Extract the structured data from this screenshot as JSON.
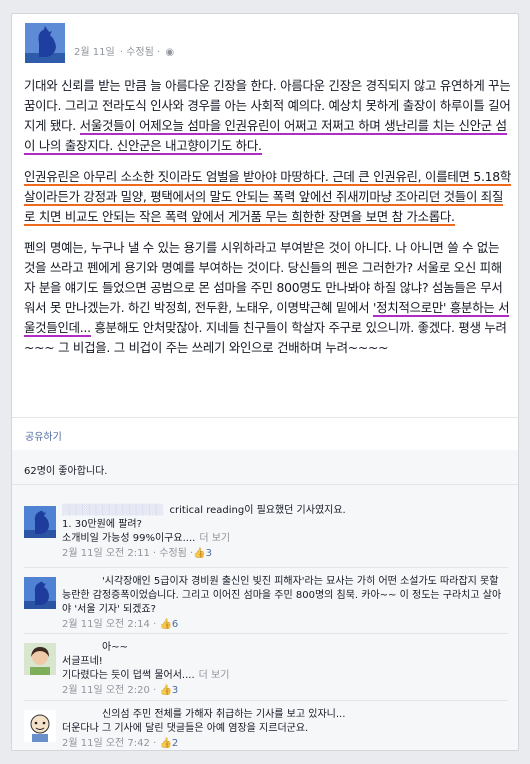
{
  "post": {
    "date": "2월 11일",
    "edited": "· 수정됨 ·",
    "paragraphs": [
      [
        {
          "t": "기대와 신뢰를 받는 만큼 늘 아름다운 긴장을 한다. 아름다운 긴장은 경직되지 않고 유연하게 꾸는 꿈이다. 그리고 전라도식 인사와 경우를 아는 사회적 예의다. 예상치 못하게 출장이 하루이틀 길어지게 됐다. ",
          "h": ""
        },
        {
          "t": "서울것들이 어제오늘 섬마을 인권유린이 어쩌고 저쩌고 하며 생난리를 치는 신안군 섬이 나의 출장지다. 신안군은 내고향이기도 하다.",
          "h": "purple"
        }
      ],
      [
        {
          "t": "인권유린은 아무리 소소한 짓이라도 엄벌을 받아야 마땅하다. 근데 큰 인권유린, 이를테면 5.18학살이라든가 강정과 밀양, 평택에서의 말도 안되는 폭력 앞에선 쥐새끼마냥 조아리던 것들이 죄질로 치면 비교도 안되는 작은 폭력 앞에서 게거품 무는 희한한 장면을 보면 참 가소롭다.",
          "h": "orange"
        }
      ],
      [
        {
          "t": "펜의 명예는, 누구나 낼 수 있는 용기를 시위하라고 부여받은 것이 아니다. 나 아니면 쓸 수 없는 것을 쓰라고 펜에게 용기와 명예를 부여하는 것이다. 당신들의 펜은 그러한가? 서울로 오신 피해자 분을 얘기도 들었으면 공범으로 몬 섬마을 주민 800명도 만나봐야 하질 않냐? 섬놈들은 무서워서 못 만나겠는가. 하긴 박정희, 전두환, 노태우, 이명박근혜 밑에서 ",
          "h": ""
        },
        {
          "t": "'정치적으로만' 흥분하는 서울것들인데...",
          "h": "purple"
        },
        {
          "t": " 흥분해도 안처맞잖아. 지네들 친구들이 학살자 주구로 있으니까. 좋겠다. 평생 누려~~~ 그 비겁을. 그 비겁이 주는 쓰레기 와인으로 건배하며 누려~~~~",
          "h": ""
        }
      ]
    ]
  },
  "actions": {
    "share": "공유하기"
  },
  "likes": "62명이 좋아합니다.",
  "comments": [
    {
      "name": "▒▒▒▒▒▒▒▒▒▒▒▒▒▒▒",
      "blurred": true,
      "inline": "critical reading이 필요했던 기사였지요.",
      "lines": [
        "1. 30만원에 팔려?",
        "소개비일 가능성 99%이구요...."
      ],
      "more": "더 보기",
      "time": "2월 11일 오전 2:11",
      "edited": "· 수정됨 ·",
      "likes": "3",
      "avatar": "blue-rooster"
    },
    {
      "name": "",
      "blurred": false,
      "inline": "'시각장애인 5급이자 경비원 출신인 빚진 피해자'라는 묘사는 가히 어떤 소설가도 따라잡지 못할 능란한 감정증폭이었습니다. 그리고 이어진 섬마을 주민 800명의 침묵. 카아~~ 이 정도는 구라치고 살아야 '서울 기자' 되겠죠?",
      "lines": [],
      "more": "",
      "time": "2월 11일 오전 2:14",
      "edited": "",
      "likes": "6",
      "avatar": "blue-rooster"
    },
    {
      "name": "",
      "blurred": false,
      "inline": "아~~",
      "lines": [
        "서글프네!",
        "기다렸다는 듯이 덥썩 물어서...."
      ],
      "more": "더 보기",
      "time": "2월 11일 오전 2:20",
      "edited": "",
      "likes": "3",
      "avatar": "woman-photo"
    },
    {
      "name": "",
      "blurred": false,
      "inline": "신의섬 주민 전체를 가해자 취급하는 기사를 보고 있자니...",
      "lines": [
        "더운다나 그 기사에 달린 댓글들은 아예 염장을 지르더군요."
      ],
      "more": "",
      "time": "2월 11일 오전 7:42",
      "edited": "",
      "likes": "2",
      "avatar": "cartoon"
    }
  ],
  "colors": {
    "link": "#3b5998",
    "purple_mark": "#b12bc7",
    "orange_mark": "#ef6a1f"
  }
}
